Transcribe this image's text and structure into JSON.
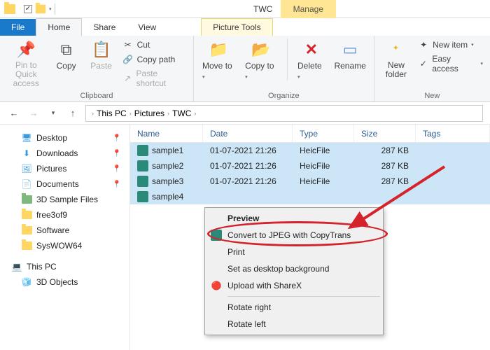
{
  "window": {
    "title": "TWC",
    "context_tab_group": "Manage",
    "context_tab": "Picture Tools"
  },
  "tabs": {
    "file": "File",
    "home": "Home",
    "share": "Share",
    "view": "View"
  },
  "ribbon": {
    "clipboard": {
      "label": "Clipboard",
      "pin": "Pin to Quick access",
      "copy": "Copy",
      "paste": "Paste",
      "cut": "Cut",
      "copy_path": "Copy path",
      "paste_shortcut": "Paste shortcut"
    },
    "organize": {
      "label": "Organize",
      "move_to": "Move to",
      "copy_to": "Copy to",
      "delete": "Delete",
      "rename": "Rename"
    },
    "new": {
      "label": "New",
      "new_folder": "New folder",
      "new_item": "New item",
      "easy_access": "Easy access"
    }
  },
  "breadcrumb": {
    "root": "This PC",
    "mid": "Pictures",
    "leaf": "TWC"
  },
  "sidebar": {
    "items": [
      {
        "label": "Desktop",
        "pin": true
      },
      {
        "label": "Downloads",
        "pin": true
      },
      {
        "label": "Pictures",
        "pin": true
      },
      {
        "label": "Documents",
        "pin": true
      },
      {
        "label": "3D Sample Files"
      },
      {
        "label": "free3of9"
      },
      {
        "label": "Software"
      },
      {
        "label": "SysWOW64"
      }
    ],
    "this_pc": "This PC",
    "objects3d": "3D Objects"
  },
  "columns": {
    "name": "Name",
    "date": "Date",
    "type": "Type",
    "size": "Size",
    "tags": "Tags"
  },
  "files": [
    {
      "name": "sample1",
      "date": "01-07-2021 21:26",
      "type": "HeicFile",
      "size": "287 KB"
    },
    {
      "name": "sample2",
      "date": "01-07-2021 21:26",
      "type": "HeicFile",
      "size": "287 KB"
    },
    {
      "name": "sample3",
      "date": "01-07-2021 21:26",
      "type": "HeicFile",
      "size": "287 KB"
    },
    {
      "name": "sample4",
      "date": "",
      "type": "",
      "size": ""
    }
  ],
  "context_menu": {
    "preview": "Preview",
    "convert": "Convert to JPEG with CopyTrans",
    "print": "Print",
    "set_bg": "Set as desktop background",
    "sharex": "Upload with ShareX",
    "rot_right": "Rotate right",
    "rot_left": "Rotate left"
  }
}
